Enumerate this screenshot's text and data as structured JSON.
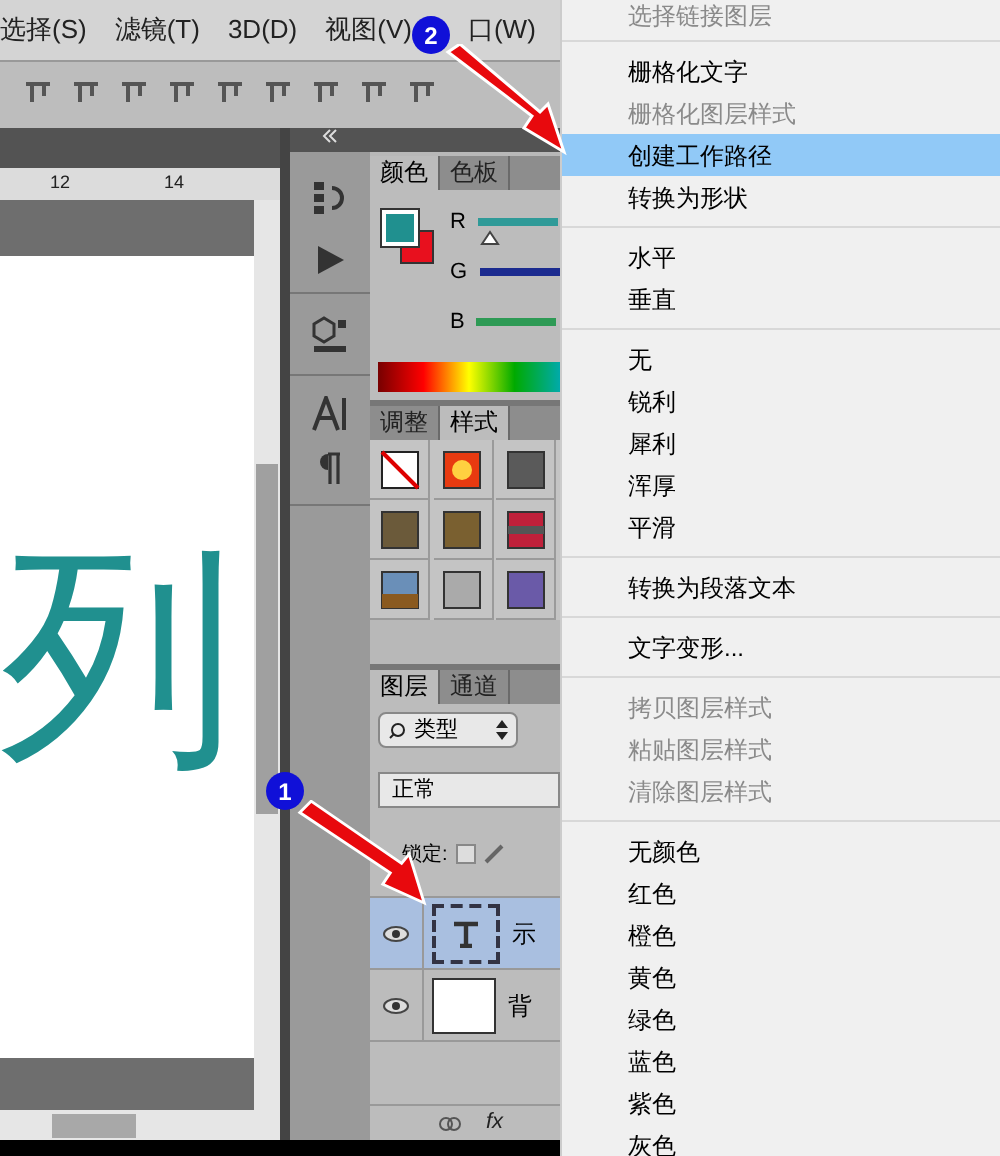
{
  "menubar": [
    {
      "label": "选择(S)"
    },
    {
      "label": "滤镜(T)"
    },
    {
      "label": "3D(D)"
    },
    {
      "label": "视图(V)"
    },
    {
      "label": "口(W)"
    }
  ],
  "ruler": [
    "12",
    "14"
  ],
  "canvas": {
    "text": "列"
  },
  "color_panel": {
    "tabs": [
      {
        "label": "颜色",
        "selected": true
      },
      {
        "label": "色板",
        "selected": false
      }
    ],
    "channels": [
      {
        "label": "R",
        "color": "#2f9a98"
      },
      {
        "label": "G",
        "color": "#1b2b8f"
      },
      {
        "label": "B",
        "color": "#2e9a55"
      }
    ]
  },
  "styles_panel": {
    "tabs": [
      {
        "label": "调整",
        "selected": false
      },
      {
        "label": "样式",
        "selected": true
      }
    ]
  },
  "layers_panel": {
    "tabs": [
      {
        "label": "图层",
        "selected": true
      },
      {
        "label": "通道",
        "selected": false
      }
    ],
    "filter": "类型",
    "blend_mode": "正常",
    "lock_label": "锁定:",
    "layers": [
      {
        "name": "示",
        "kind": "text",
        "selected": true
      },
      {
        "name": "背",
        "kind": "background",
        "selected": false
      }
    ],
    "footer": "fx"
  },
  "context_menu": {
    "groups": [
      [
        {
          "label": "选择链接图层",
          "disabled": true,
          "selected": false
        }
      ],
      [
        {
          "label": "栅格化文字",
          "disabled": false,
          "selected": false
        },
        {
          "label": "栅格化图层样式",
          "disabled": true,
          "selected": false
        },
        {
          "label": "创建工作路径",
          "disabled": false,
          "selected": true
        },
        {
          "label": "转换为形状",
          "disabled": false,
          "selected": false
        }
      ],
      [
        {
          "label": "水平",
          "disabled": false,
          "selected": false
        },
        {
          "label": "垂直",
          "disabled": false,
          "selected": false
        }
      ],
      [
        {
          "label": "无",
          "disabled": false,
          "selected": false
        },
        {
          "label": "锐利",
          "disabled": false,
          "selected": false
        },
        {
          "label": "犀利",
          "disabled": false,
          "selected": false
        },
        {
          "label": "浑厚",
          "disabled": false,
          "selected": false
        },
        {
          "label": "平滑",
          "disabled": false,
          "selected": false
        }
      ],
      [
        {
          "label": "转换为段落文本",
          "disabled": false,
          "selected": false
        }
      ],
      [
        {
          "label": "文字变形...",
          "disabled": false,
          "selected": false
        }
      ],
      [
        {
          "label": "拷贝图层样式",
          "disabled": true,
          "selected": false
        },
        {
          "label": "粘贴图层样式",
          "disabled": true,
          "selected": false
        },
        {
          "label": "清除图层样式",
          "disabled": true,
          "selected": false
        }
      ],
      [
        {
          "label": "无颜色",
          "disabled": false,
          "selected": false
        },
        {
          "label": "红色",
          "disabled": false,
          "selected": false
        },
        {
          "label": "橙色",
          "disabled": false,
          "selected": false
        },
        {
          "label": "黄色",
          "disabled": false,
          "selected": false
        },
        {
          "label": "绿色",
          "disabled": false,
          "selected": false
        },
        {
          "label": "蓝色",
          "disabled": false,
          "selected": false
        },
        {
          "label": "紫色",
          "disabled": false,
          "selected": false
        },
        {
          "label": "灰色",
          "disabled": false,
          "selected": false
        }
      ]
    ]
  },
  "annotations": [
    {
      "label": "2"
    },
    {
      "label": "1"
    }
  ]
}
